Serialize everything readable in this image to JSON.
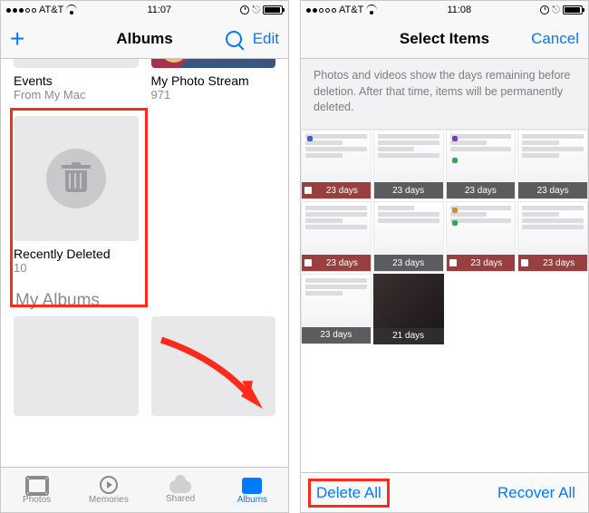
{
  "s1": {
    "status": {
      "carrier": "AT&T",
      "time": "11:07"
    },
    "nav": {
      "title": "Albums",
      "edit": "Edit"
    },
    "albums": {
      "r1": [
        {
          "name": "Events",
          "sub": "From My Mac"
        },
        {
          "name": "My Photo Stream",
          "sub": "971"
        }
      ],
      "r2": [
        {
          "name": "Recently Deleted",
          "sub": "10"
        }
      ]
    },
    "section": "My Albums",
    "tabs": {
      "photos": "Photos",
      "memories": "Memories",
      "shared": "Shared",
      "albums": "Albums"
    }
  },
  "s2": {
    "status": {
      "carrier": "AT&T",
      "time": "11:08"
    },
    "nav": {
      "title": "Select Items",
      "cancel": "Cancel"
    },
    "banner": "Photos and videos show the days remaining before deletion. After that time, items will be permanently deleted.",
    "days": [
      "23 days",
      "23 days",
      "23 days",
      "23 days",
      "23 days",
      "23 days",
      "23 days",
      "23 days",
      "23 days",
      "21 days"
    ],
    "toolbar": {
      "delete": "Delete All",
      "recover": "Recover All"
    }
  }
}
